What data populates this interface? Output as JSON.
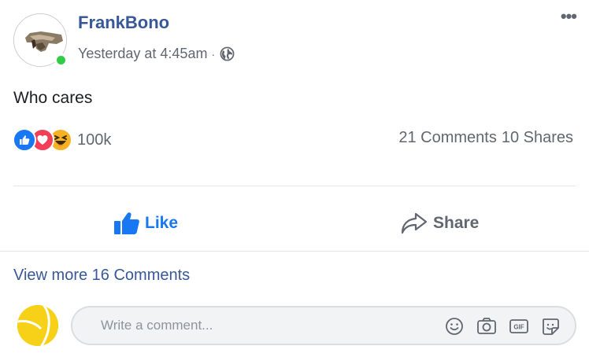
{
  "post": {
    "author": "FrankBono",
    "timestamp": "Yesterday at 4:45am",
    "separator": "·",
    "privacy_icon": "globe-icon",
    "text": "Who cares",
    "more_icon": "•••"
  },
  "reactions": {
    "types": [
      "like",
      "love",
      "haha"
    ],
    "count": "100k",
    "comments": "21 Comments",
    "shares": "10 Shares"
  },
  "actions": {
    "like_label": "Like",
    "share_label": "Share"
  },
  "comments": {
    "view_more": "View more 16 Comments"
  },
  "composer": {
    "placeholder": "Write a comment...",
    "tools": [
      "emoji-icon",
      "camera-icon",
      "gif-icon",
      "sticker-icon"
    ]
  },
  "colors": {
    "link": "#385898",
    "like_blue": "#1877f2",
    "love_red": "#f33e58",
    "haha_yellow": "#f7b125",
    "online_green": "#31cc46",
    "muted": "#606770"
  }
}
